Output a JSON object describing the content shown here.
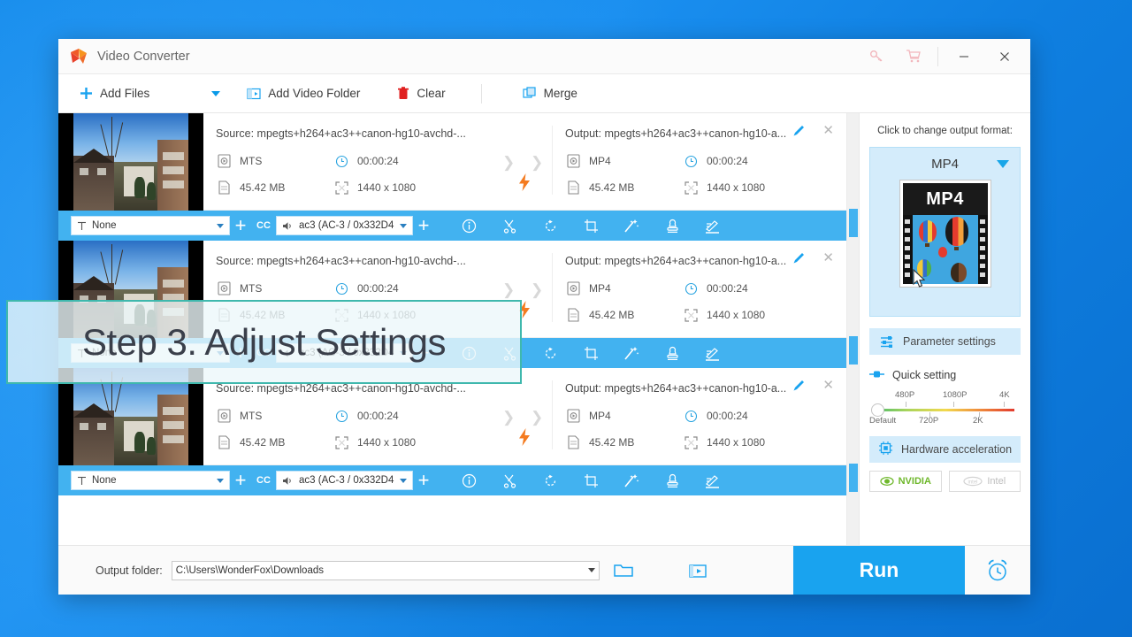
{
  "window": {
    "title": "Video Converter",
    "logo_icon": "play-logo-icon",
    "controls": [
      {
        "name": "key-icon",
        "label": "⚿"
      },
      {
        "name": "cart-icon",
        "label": "🛒"
      },
      {
        "name": "minimize-button",
        "label": "—"
      },
      {
        "name": "close-button",
        "label": "✕"
      }
    ]
  },
  "toolbar": {
    "add_files": "Add Files",
    "add_files_icon": "plus-icon",
    "dropdown_icon": "chevron-down-icon",
    "add_video_folder": "Add Video Folder",
    "add_video_folder_icon": "folder-video-icon",
    "clear": "Clear",
    "clear_icon": "trash-icon",
    "merge": "Merge",
    "merge_icon": "merge-squares-icon"
  },
  "file_list": {
    "rows": [
      {
        "source_title": "Source: mpegts+h264+ac3++canon-hg10-avchd-...",
        "output_title": "Output: mpegts+h264+ac3++canon-hg10-a...",
        "source": {
          "format": "MTS",
          "duration": "00:00:24",
          "size": "45.42 MB",
          "resolution": "1440 x 1080"
        },
        "output": {
          "format": "MP4",
          "duration": "00:00:24",
          "size": "45.42 MB",
          "resolution": "1440 x 1080"
        }
      },
      {
        "source_title": "Source: mpegts+h264+ac3++canon-hg10-avchd-...",
        "output_title": "Output: mpegts+h264+ac3++canon-hg10-a...",
        "source": {
          "format": "MTS",
          "duration": "00:00:24",
          "size": "45.42 MB",
          "resolution": "1440 x 1080"
        },
        "output": {
          "format": "MP4",
          "duration": "00:00:24",
          "size": "45.42 MB",
          "resolution": "1440 x 1080"
        }
      },
      {
        "source_title": "Source: mpegts+h264+ac3++canon-hg10-avchd-...",
        "output_title": "Output: mpegts+h264+ac3++canon-hg10-a...",
        "source": {
          "format": "MTS",
          "duration": "00:00:24",
          "size": "45.42 MB",
          "resolution": "1440 x 1080"
        },
        "output": {
          "format": "MP4",
          "duration": "00:00:24",
          "size": "45.42 MB",
          "resolution": "1440 x 1080"
        }
      }
    ],
    "settings_bar": {
      "subtitle_value": "None",
      "subtitle_icon": "text-subtitle-icon",
      "add_subtitle_icon": "plus-icon",
      "cc_label": "CC",
      "audio_value": "ac3 (AC-3 / 0x332D4",
      "audio_icon": "speaker-icon",
      "add_audio_icon": "plus-icon",
      "tools": [
        {
          "name": "info-icon",
          "glyph": "i"
        },
        {
          "name": "cut-scissors-icon",
          "glyph": "✂"
        },
        {
          "name": "rotate-icon",
          "glyph": "↺"
        },
        {
          "name": "crop-icon",
          "glyph": "⌧"
        },
        {
          "name": "effects-wand-icon",
          "glyph": "✧"
        },
        {
          "name": "watermark-stamp-icon",
          "glyph": "⚑"
        },
        {
          "name": "edit-subtitle-icon",
          "glyph": "✎"
        }
      ]
    }
  },
  "right_panel": {
    "prompt": "Click to change output format:",
    "format_name": "MP4",
    "format_caret_icon": "chevron-down-icon",
    "poster_label": "MP4",
    "parameter_settings": "Parameter settings",
    "parameter_settings_icon": "sliders-icon",
    "quick_setting": "Quick setting",
    "quick_setting_icon": "quick-toggle-icon",
    "slider": {
      "top_labels": [
        "480P",
        "1080P",
        "4K"
      ],
      "bottom_labels": [
        "Default",
        "720P",
        "2K"
      ],
      "handle_position": "Default"
    },
    "hardware_acceleration": "Hardware acceleration",
    "hardware_acceleration_icon": "chip-icon",
    "gpus": [
      {
        "label": "NVIDIA",
        "state": "on",
        "icon": "nvidia-eye-icon"
      },
      {
        "label": "Intel",
        "state": "off",
        "icon": "intel-logo-icon"
      }
    ]
  },
  "bottom": {
    "output_folder_label": "Output folder:",
    "output_folder_value": "C:\\Users\\WonderFox\\Downloads",
    "open_folder_icon": "folder-open-icon",
    "media_folder_icon": "folder-media-icon",
    "run_label": "Run",
    "alarm_icon": "alarm-clock-icon"
  },
  "overlay": {
    "text": "Step 3. Adjust Settings",
    "border_color": "#3fb8ad"
  },
  "colors": {
    "accent": "#19a3ef",
    "settings_bar": "#42b2f0",
    "panel_highlight": "#d4ecfb",
    "bolt": "#f47b20",
    "nvidia": "#6fb82c",
    "desktop": "#0a84e8"
  }
}
